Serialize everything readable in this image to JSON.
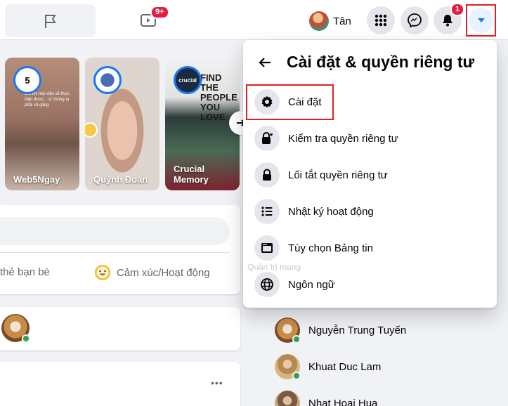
{
  "topbar": {
    "video_badge": "9+",
    "notification_badge": "1",
    "profile_name": "Tân",
    "icons": [
      "flag-icon",
      "video-icon",
      "apps-grid-icon",
      "messenger-icon",
      "bell-icon",
      "caret-down-icon"
    ]
  },
  "stories": [
    {
      "name": "Web5Ngay",
      "avatar_text": "5",
      "body_text": "Đôi khi mọi việc sẽ thực hiện được... vì chúng ta phải cố gắng"
    },
    {
      "name": "Quỳnh Đoàn"
    },
    {
      "name": "Crucial Memory",
      "avatar_text": "crucial",
      "body_text": "FIND THE PEOPLE YOU LOVE"
    }
  ],
  "composer": {
    "tag_friends": "thẻ bạn bè",
    "feeling": "Cảm xúc/Hoạt động"
  },
  "settings_menu": {
    "title": "Cài đặt & quyền riêng tư",
    "items": [
      {
        "label": "Cài đặt",
        "icon": "gear-icon"
      },
      {
        "label": "Kiểm tra quyền riêng tư",
        "icon": "lock-heart-icon"
      },
      {
        "label": "Lối tắt quyền riêng tư",
        "icon": "lock-icon"
      },
      {
        "label": "Nhật ký hoạt động",
        "icon": "list-icon"
      },
      {
        "label": "Tùy chọn Bảng tin",
        "icon": "newsfeed-icon"
      },
      {
        "label": "Ngôn ngữ",
        "icon": "globe-icon"
      }
    ]
  },
  "watermark": "Quản trị mạng",
  "contacts": [
    {
      "name": "Nguyễn Trung Tuyến"
    },
    {
      "name": "Khuat Duc Lam"
    },
    {
      "name": "Nhat Hoai Hua"
    }
  ],
  "post_menu": "•••",
  "colors": {
    "accent": "#1877f2",
    "highlight_box": "#e02020",
    "badge": "#e41e3f",
    "online": "#31a24c"
  }
}
